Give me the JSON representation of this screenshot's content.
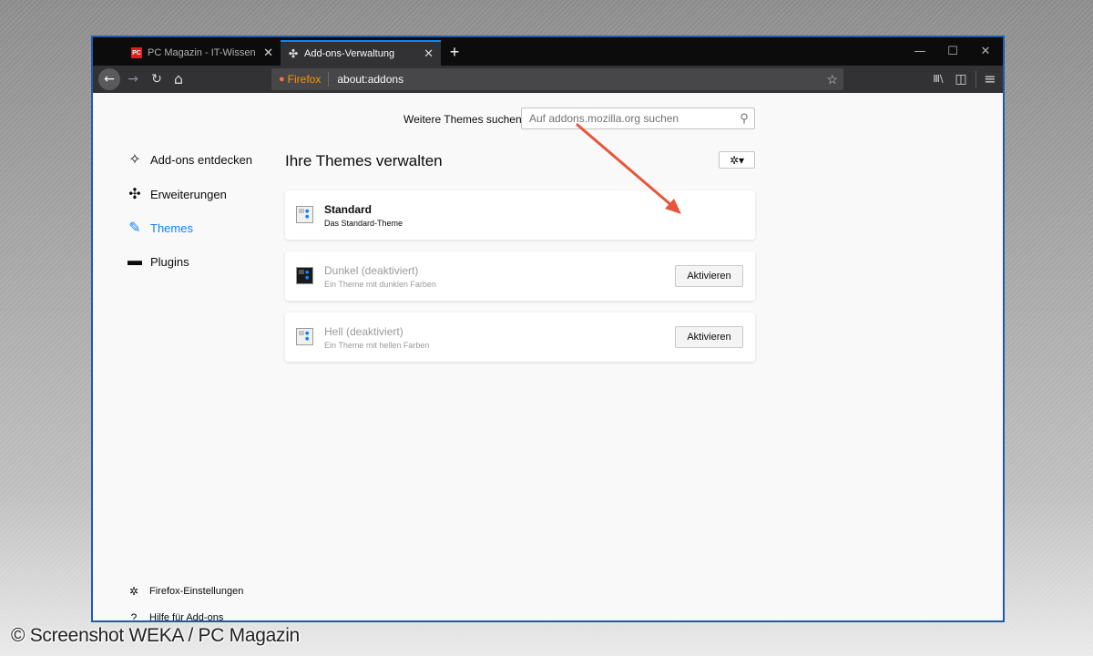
{
  "tabs": [
    {
      "label": "PC Magazin - IT-Wissen ohne F",
      "favicon": "PC",
      "active": false
    },
    {
      "label": "Add-ons-Verwaltung",
      "favicon": "puzzle-icon",
      "active": true
    }
  ],
  "new_tab_symbol": "+",
  "window_controls": {
    "minimize": "—",
    "maximize": "☐",
    "close": "✕"
  },
  "navbar": {
    "back_symbol": "←",
    "forward_symbol": "→",
    "reload_symbol": "↻",
    "home_symbol": "⌂",
    "url_brand": "Firefox",
    "url": "about:addons",
    "library_symbol": "Ⅲ\\",
    "sidebar_symbol": "◫",
    "menu_symbol": "≡"
  },
  "search": {
    "label": "Weitere Themes suchen",
    "placeholder": "Auf addons.mozilla.org suchen"
  },
  "sidebar": {
    "items": [
      {
        "label": "Add-ons entdecken",
        "icon": "discover-icon",
        "active": false
      },
      {
        "label": "Erweiterungen",
        "icon": "puzzle-icon",
        "active": false
      },
      {
        "label": "Themes",
        "icon": "brush-icon",
        "active": true
      },
      {
        "label": "Plugins",
        "icon": "plugin-icon",
        "active": false
      }
    ],
    "footer": [
      {
        "label": "Firefox-Einstellungen",
        "icon": "gear-icon"
      },
      {
        "label": "Hilfe für Add-ons",
        "icon": "help-icon"
      }
    ]
  },
  "main": {
    "heading": "Ihre Themes verwalten",
    "tools_symbol": "✲▾",
    "themes": [
      {
        "name": "Standard",
        "description": "Das Standard-Theme",
        "enabled": true,
        "button": ""
      },
      {
        "name": "Dunkel (deaktiviert)",
        "description": "Ein Theme mit dunklen Farben",
        "enabled": false,
        "button": "Aktivieren"
      },
      {
        "name": "Hell (deaktiviert)",
        "description": "Ein Theme mit hellen Farben",
        "enabled": false,
        "button": "Aktivieren"
      }
    ]
  },
  "watermark": "© Screenshot WEKA / PC Magazin",
  "colors": {
    "accent": "#0a84ff",
    "annotation_arrow": "#e8553b",
    "window_border": "#1e5ba8"
  }
}
